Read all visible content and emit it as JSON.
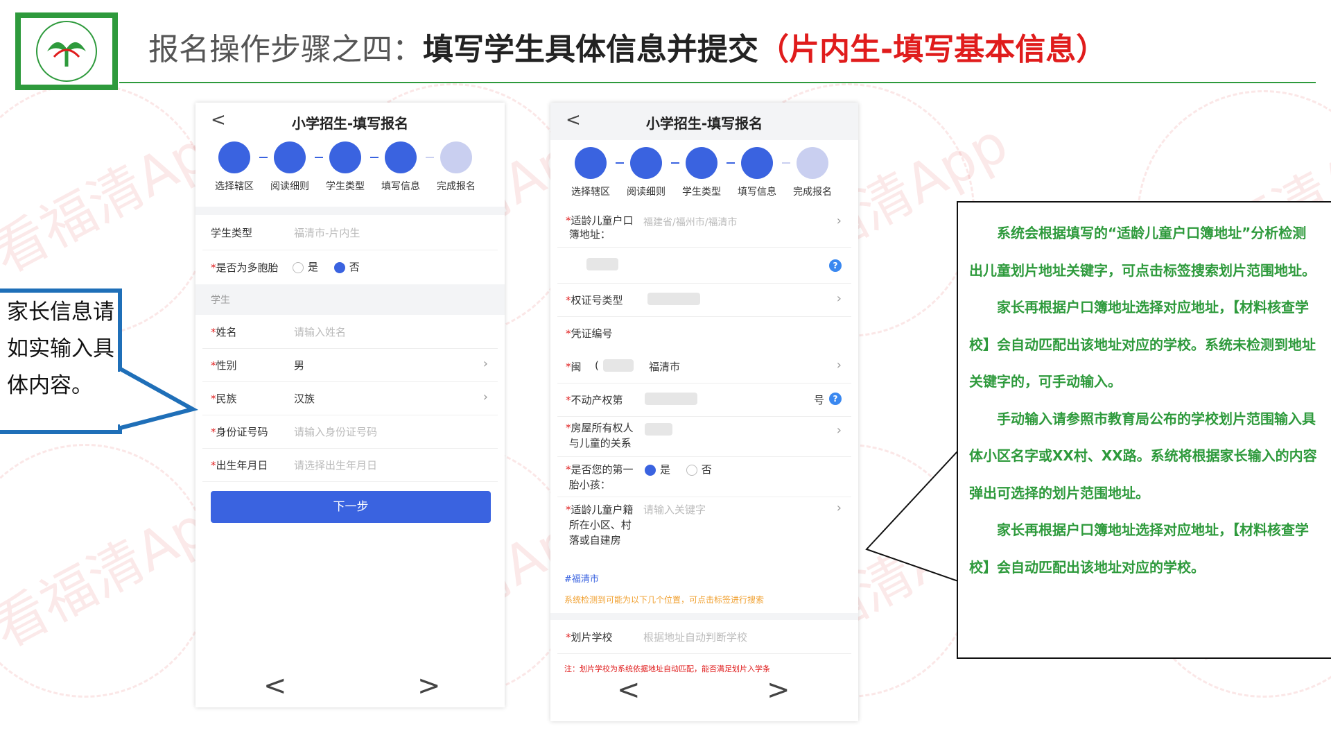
{
  "header": {
    "title_part1": "报名操作步骤之四：",
    "title_part2": "填写学生具体信息并提交",
    "title_part3": "（片内生-填写基本信息）",
    "accent_color": "#2e9a3c",
    "highlight_color": "#e01c1c"
  },
  "watermark": {
    "text": "看福清App"
  },
  "phone_left": {
    "back_icon": "chevron-left-icon",
    "title": "小学招生-填写报名",
    "steps": [
      "选择辖区",
      "阅读细则",
      "学生类型",
      "填写信息",
      "完成报名"
    ],
    "student_type_label": "学生类型",
    "student_type_value": "福清市-片内生",
    "multiple_birth_label": "是否为多胞胎",
    "yes": "是",
    "no": "否",
    "section_label": "学生",
    "name_label": "姓名",
    "name_placeholder": "请输入姓名",
    "gender_label": "性别",
    "gender_value": "男",
    "ethnicity_label": "民族",
    "ethnicity_value": "汉族",
    "id_label": "身份证号码",
    "id_placeholder": "请输入身份证号码",
    "birth_label": "出生年月日",
    "birth_placeholder": "请选择出生年月日",
    "next_button": "下一步",
    "prev_page": "<",
    "next_page": ">"
  },
  "phone_right": {
    "title": "小学招生-填写报名",
    "steps": [
      "选择辖区",
      "阅读细则",
      "学生类型",
      "填写信息",
      "完成报名"
    ],
    "household_label_1": "适龄儿童户口",
    "household_label_2": "簿地址：",
    "household_value": "福建省/福州市/福清市",
    "cert_type_label": "权证号类型",
    "cert_no_label": "凭证编号",
    "min_label": "闽",
    "min_prefix": "(",
    "min_value": "福清市",
    "property_label": "不动产权第",
    "property_suffix": "号",
    "owner_label_1": "房屋所有权人",
    "owner_label_2": "与儿童的关系",
    "first_child_label_1": "是否您的第一",
    "first_child_label_2": "胎小孩：",
    "yes": "是",
    "no": "否",
    "residence_label_1": "适龄儿童户籍",
    "residence_label_2": "所在小区、村",
    "residence_label_3": "落或自建房",
    "residence_placeholder": "请输入关键字",
    "tag": "#福清市",
    "detect_note": "系统检测到可能为以下几个位置，可点击标签进行搜索",
    "school_label": "划片学校",
    "school_placeholder": "根据地址自动判断学校",
    "school_note": "注：划片学校为系统依据地址自动匹配，能否满足划片入学条",
    "help_icon_text": "?",
    "prev_page": "<",
    "next_page": ">"
  },
  "callout_left": {
    "text": "家长信息请如实输入具体内容。"
  },
  "callout_right": {
    "paragraphs": [
      "系统会根据填写的“适龄儿童户口簿地址”分析检测出儿童划片地址关键字，可点击标签搜索划片范围地址。",
      "家长再根据户口簿地址选择对应地址，【材料核查学校】会自动匹配出该地址对应的学校。系统未检测到地址关键字的，可手动输入。",
      "手动输入请参照市教育局公布的学校划片范围输入具体小区名字或XX村、XX路。系统将根据家长输入的内容弹出可选择的划片范围地址。",
      "家长再根据户口簿地址选择对应地址，【材料核查学校】会自动匹配出该地址对应的学校。"
    ]
  }
}
